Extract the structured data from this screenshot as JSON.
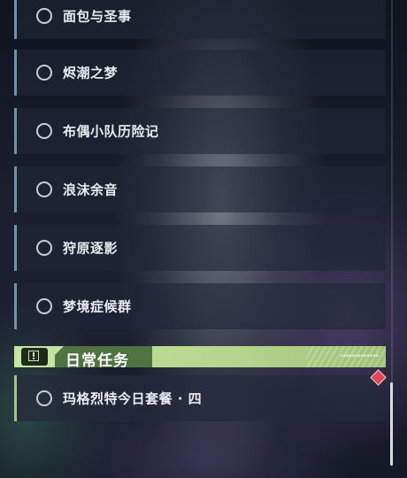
{
  "quests": [
    {
      "label": "面包与圣事"
    },
    {
      "label": "烬潮之梦"
    },
    {
      "label": "布偶小队历险记"
    },
    {
      "label": "浪沫余音"
    },
    {
      "label": "狩原逐影"
    },
    {
      "label": "梦境症候群"
    }
  ],
  "daily_section": {
    "title": "日常任务",
    "icon": "alert-icon",
    "accent_color": "#b3d58d",
    "tab_color": "#4f7441"
  },
  "daily_quests": [
    {
      "label": "玛格烈特今日套餐 · 四"
    }
  ],
  "colors": {
    "quest_border": "#6f93a6",
    "daily_border": "#9fc489",
    "marker": "#e0465a"
  }
}
